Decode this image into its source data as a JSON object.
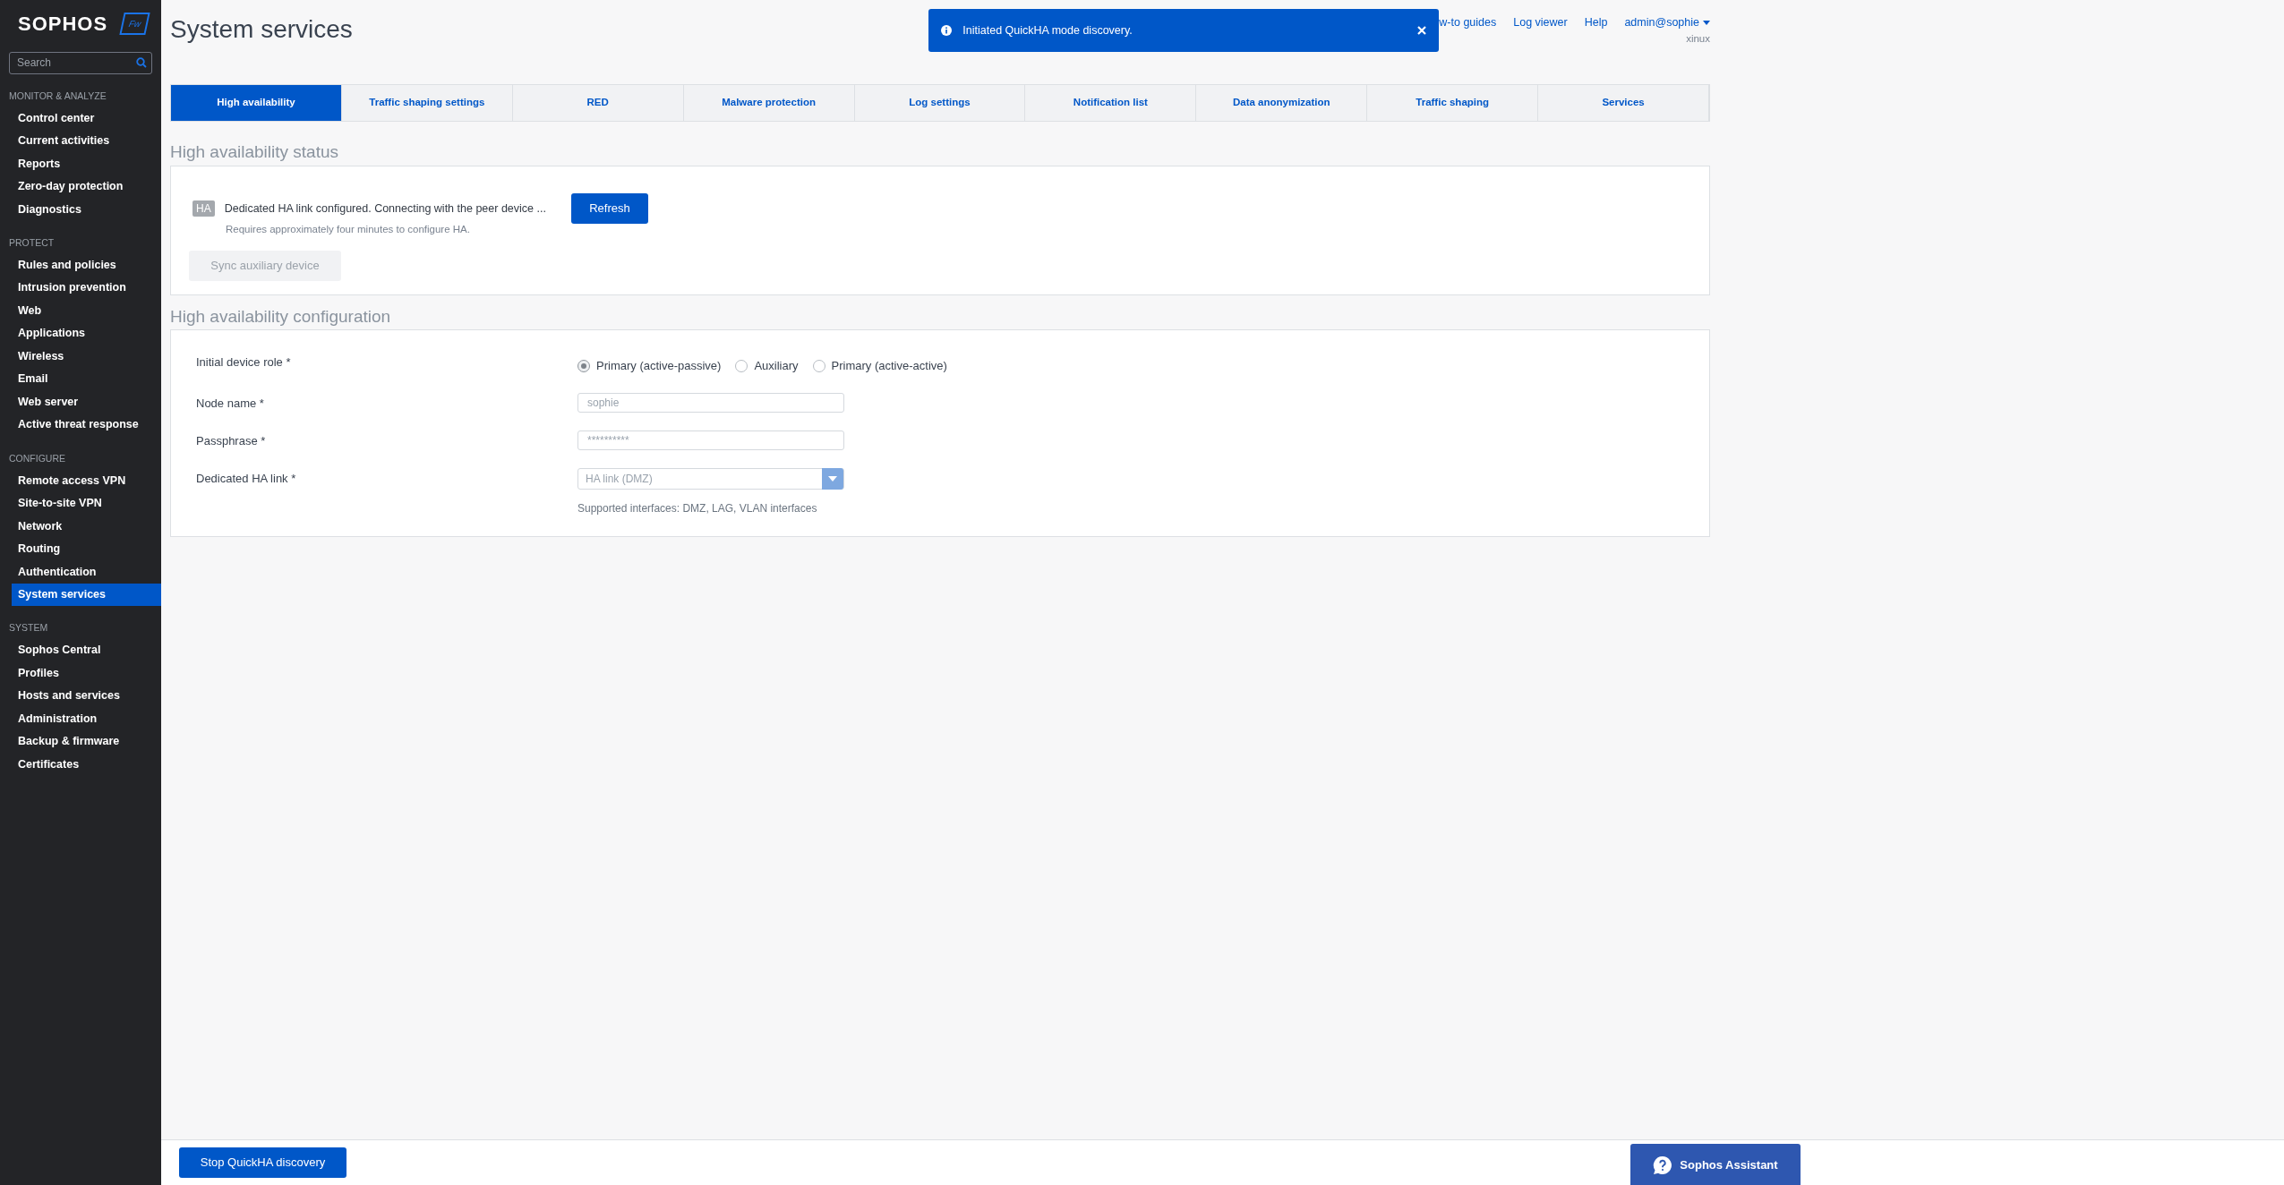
{
  "sidebar": {
    "logo": "SOPHOS",
    "badge": "Fw",
    "search": {
      "placeholder": "Search"
    },
    "sections": [
      {
        "title": "MONITOR & ANALYZE",
        "items": [
          {
            "label": "Control center",
            "selected": false
          },
          {
            "label": "Current activities",
            "selected": false
          },
          {
            "label": "Reports",
            "selected": false
          },
          {
            "label": "Zero-day protection",
            "selected": false
          },
          {
            "label": "Diagnostics",
            "selected": false
          }
        ]
      },
      {
        "title": "PROTECT",
        "items": [
          {
            "label": "Rules and policies",
            "selected": false
          },
          {
            "label": "Intrusion prevention",
            "selected": false
          },
          {
            "label": "Web",
            "selected": false
          },
          {
            "label": "Applications",
            "selected": false
          },
          {
            "label": "Wireless",
            "selected": false
          },
          {
            "label": "Email",
            "selected": false
          },
          {
            "label": "Web server",
            "selected": false
          },
          {
            "label": "Active threat response",
            "selected": false
          }
        ]
      },
      {
        "title": "CONFIGURE",
        "items": [
          {
            "label": "Remote access VPN",
            "selected": false
          },
          {
            "label": "Site-to-site VPN",
            "selected": false
          },
          {
            "label": "Network",
            "selected": false
          },
          {
            "label": "Routing",
            "selected": false
          },
          {
            "label": "Authentication",
            "selected": false
          },
          {
            "label": "System services",
            "selected": true
          }
        ]
      },
      {
        "title": "SYSTEM",
        "items": [
          {
            "label": "Sophos Central",
            "selected": false
          },
          {
            "label": "Profiles",
            "selected": false
          },
          {
            "label": "Hosts and services",
            "selected": false
          },
          {
            "label": "Administration",
            "selected": false
          },
          {
            "label": "Backup & firmware",
            "selected": false
          },
          {
            "label": "Certificates",
            "selected": false
          }
        ]
      }
    ]
  },
  "header": {
    "title": "System services",
    "toast": {
      "message": "Initiated QuickHA mode discovery."
    },
    "links": [
      "w-to guides",
      "Log viewer",
      "Help"
    ],
    "user": "admin@sophie",
    "subtitle": "xinux"
  },
  "tabs": [
    {
      "label": "High availability",
      "selected": true
    },
    {
      "label": "Traffic shaping settings",
      "selected": false
    },
    {
      "label": "RED",
      "selected": false
    },
    {
      "label": "Malware protection",
      "selected": false
    },
    {
      "label": "Log settings",
      "selected": false
    },
    {
      "label": "Notification list",
      "selected": false
    },
    {
      "label": "Data anonymization",
      "selected": false
    },
    {
      "label": "Traffic shaping",
      "selected": false
    },
    {
      "label": "Services",
      "selected": false
    }
  ],
  "ha_status": {
    "heading": "High availability status",
    "badge": "HA",
    "message": "Dedicated HA link configured. Connecting with the peer device ...",
    "note": "Requires approximately four minutes to configure HA.",
    "refresh_button": "Refresh",
    "sync_button": {
      "label": "Sync auxiliary device",
      "disabled": true
    }
  },
  "ha_config": {
    "heading": "High availability configuration",
    "role": {
      "label": "Initial device role *",
      "options": [
        {
          "label": "Primary (active-passive)",
          "selected": true
        },
        {
          "label": "Auxiliary",
          "selected": false
        },
        {
          "label": "Primary (active-active)",
          "selected": false
        }
      ]
    },
    "node_name": {
      "label": "Node name *",
      "value": "sophie"
    },
    "passphrase": {
      "label": "Passphrase *",
      "value": "**********"
    },
    "ha_link": {
      "label": "Dedicated HA link *",
      "value": "HA link (DMZ)",
      "hint": "Supported interfaces: DMZ, LAG, VLAN interfaces"
    }
  },
  "footer": {
    "stop_button": "Stop QuickHA discovery",
    "assistant": "Sophos Assistant"
  }
}
